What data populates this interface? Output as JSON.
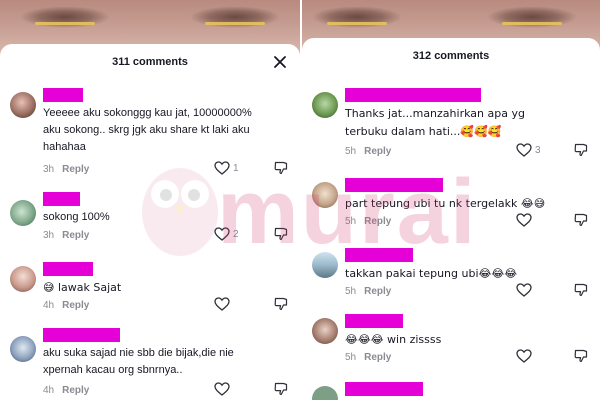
{
  "left_panel": {
    "header": {
      "comment_count": "311 comments"
    },
    "comments": [
      {
        "text": "Yeeeee aku sokonggg kau jat, 10000000% aku sokong.. skrg jgk aku share kt laki aku hahahaa",
        "time": "3h",
        "reply": "Reply",
        "likes": "1"
      },
      {
        "text": "sokong 100%",
        "time": "3h",
        "reply": "Reply",
        "likes": "2"
      },
      {
        "text": "😅 lawak Sajat",
        "time": "4h",
        "reply": "Reply",
        "likes": ""
      },
      {
        "text": "aku suka sajad nie sbb die bijak,die nie xpernah kacau org sbnrnya..",
        "time": "4h",
        "reply": "Reply",
        "likes": ""
      }
    ]
  },
  "right_panel": {
    "header": {
      "comment_count": "312 comments"
    },
    "comments": [
      {
        "text": "Thanks jat...manzahirkan apa yg terbuku dalam hati...🥰🥰🥰",
        "time": "5h",
        "reply": "Reply",
        "likes": "3"
      },
      {
        "text": "part tepung ubi tu nk tergelakk 😂😅",
        "time": "5h",
        "reply": "Reply",
        "likes": ""
      },
      {
        "text": "takkan pakai tepung ubi😂😂😂",
        "time": "5h",
        "reply": "Reply",
        "likes": ""
      },
      {
        "text": "😂😂😂 win zissss",
        "time": "5h",
        "reply": "Reply",
        "likes": ""
      }
    ]
  },
  "colors": {
    "name_redaction": "#e600d8",
    "watermark": "#d33a6b"
  },
  "icons": {
    "close": "close-icon",
    "like": "heart-icon",
    "dislike": "thumbs-down-icon"
  },
  "watermark": {
    "text": "murai"
  }
}
